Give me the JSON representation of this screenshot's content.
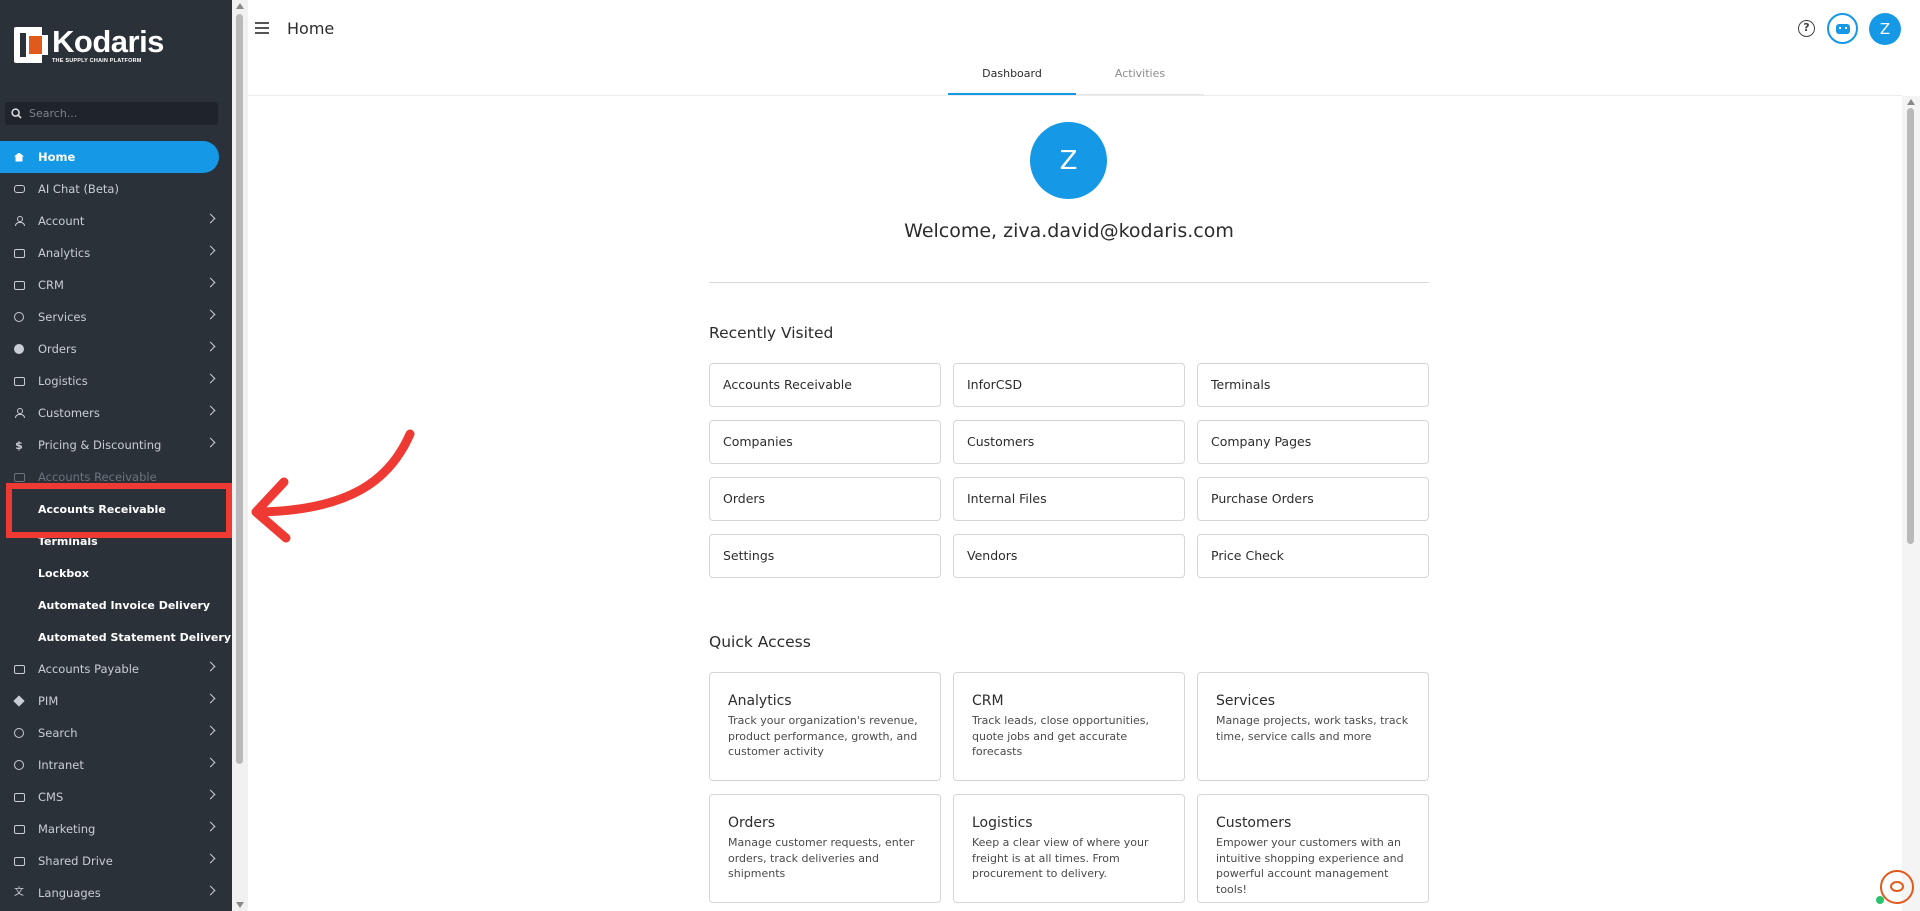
{
  "app": {
    "brand_name": "Kodaris",
    "brand_tagline": "THE SUPPLY CHAIN PLATFORM",
    "page_title": "Home"
  },
  "sidebar": {
    "search_placeholder": "Search...",
    "items": [
      {
        "label": "Home",
        "icon": "home-icon",
        "state": "active"
      },
      {
        "label": "AI Chat (Beta)",
        "icon": "robot-icon"
      },
      {
        "label": "Account",
        "icon": "user-icon",
        "chevron": true
      },
      {
        "label": "Analytics",
        "icon": "analytics-icon",
        "chevron": true
      },
      {
        "label": "CRM",
        "icon": "crm-icon",
        "chevron": true
      },
      {
        "label": "Services",
        "icon": "services-icon",
        "chevron": true
      },
      {
        "label": "Orders",
        "icon": "truck-icon",
        "chevron": true
      },
      {
        "label": "Logistics",
        "icon": "forklift-icon",
        "chevron": true
      },
      {
        "label": "Customers",
        "icon": "people-icon",
        "chevron": true
      },
      {
        "label": "Pricing & Discounting",
        "icon": "dollar-icon",
        "chevron": true
      },
      {
        "label": "Accounts Receivable",
        "icon": "bank-icon",
        "chevron": true,
        "state": "partially-hidden"
      },
      {
        "label": "Accounts Receivable",
        "sub": true,
        "state": "highlighted"
      },
      {
        "label": "Terminals",
        "sub": true,
        "state": "partially-hidden"
      },
      {
        "label": "Lockbox",
        "sub": true
      },
      {
        "label": "Automated Invoice Delivery",
        "sub": true
      },
      {
        "label": "Automated Statement Delivery",
        "sub": true
      },
      {
        "label": "Accounts Payable",
        "icon": "bank-icon",
        "chevron": true
      },
      {
        "label": "PIM",
        "icon": "tag-icon",
        "chevron": true
      },
      {
        "label": "Search",
        "icon": "search-icon",
        "chevron": true
      },
      {
        "label": "Intranet",
        "icon": "globe-icon",
        "chevron": true
      },
      {
        "label": "CMS",
        "icon": "cms-icon",
        "chevron": true
      },
      {
        "label": "Marketing",
        "icon": "marketing-icon",
        "chevron": true
      },
      {
        "label": "Shared Drive",
        "icon": "folder-icon",
        "chevron": true
      },
      {
        "label": "Languages",
        "icon": "translate-icon",
        "chevron": true
      }
    ]
  },
  "header": {
    "help_label": "?",
    "avatar_initial": "Z"
  },
  "tabs": [
    {
      "label": "Dashboard",
      "active": true
    },
    {
      "label": "Activities",
      "active": false
    }
  ],
  "dashboard": {
    "avatar_initial": "Z",
    "welcome": "Welcome, ziva.david@kodaris.com",
    "recently_visited_title": "Recently Visited",
    "recently_visited": [
      "Accounts Receivable",
      "InforCSD",
      "Terminals",
      "Companies",
      "Customers",
      "Company Pages",
      "Orders",
      "Internal Files",
      "Purchase Orders",
      "Settings",
      "Vendors",
      "Price Check"
    ],
    "quick_access_title": "Quick Access",
    "quick_access": [
      {
        "title": "Analytics",
        "desc": "Track your organization's revenue, product performance, growth, and customer activity"
      },
      {
        "title": "CRM",
        "desc": "Track leads, close opportunities, quote jobs and get accurate forecasts"
      },
      {
        "title": "Services",
        "desc": "Manage projects, work tasks, track time, service calls and more"
      },
      {
        "title": "Orders",
        "desc": "Manage customer requests, enter orders, track deliveries and shipments"
      },
      {
        "title": "Logistics",
        "desc": "Keep a clear view of where your freight is at all times. From procurement to delivery."
      },
      {
        "title": "Customers",
        "desc": "Empower your customers with an intuitive shopping experience and powerful account management tools!"
      }
    ]
  },
  "colors": {
    "accent": "#1598e6",
    "sidebar_bg": "#2b3139",
    "annotation": "#ee3a33",
    "brand_orange": "#e05a1c"
  }
}
